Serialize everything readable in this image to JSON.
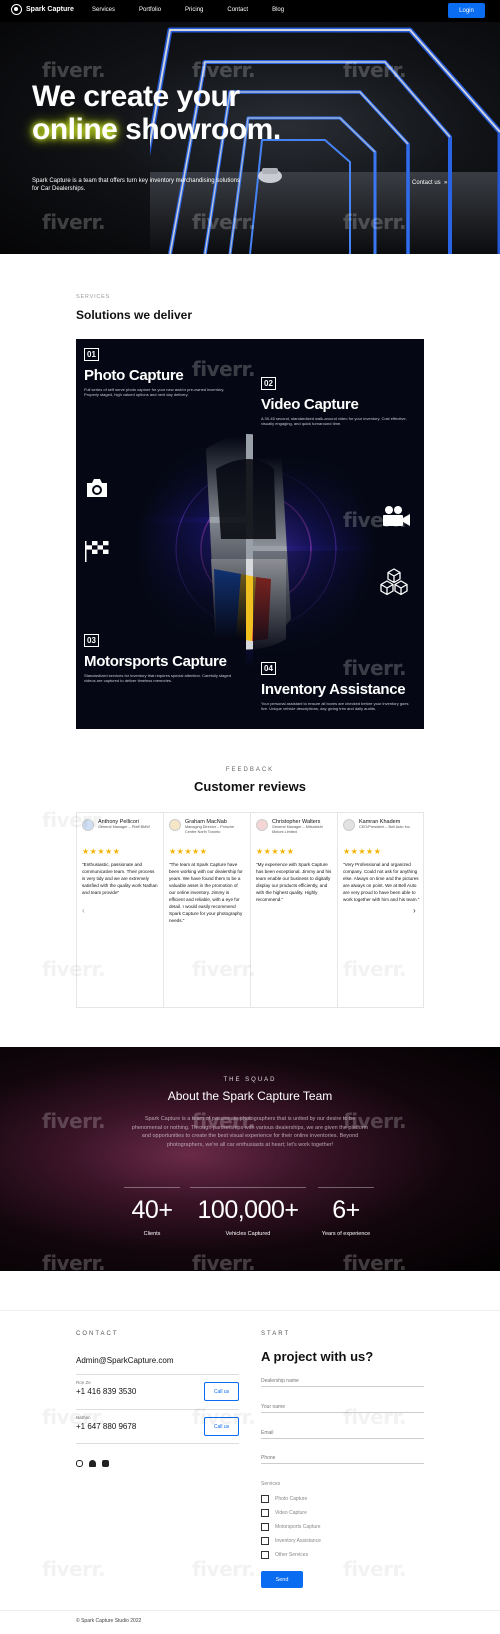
{
  "nav": {
    "brand": "Spark Capture",
    "links": [
      "Services",
      "Portfolio",
      "Pricing",
      "Contact",
      "Blog"
    ],
    "login": "Login"
  },
  "hero": {
    "line1": "We create your",
    "line2_highlight": "online",
    "line2_rest": " showroom.",
    "subtitle": "Spark Capture is a team that offers turn key inventory merchandising solutions for Car Dealerships.",
    "cta": "Contact us",
    "watermark": "fiverr."
  },
  "services": {
    "kicker": "SERVICES",
    "title": "Solutions we deliver",
    "cards": [
      {
        "num": "01",
        "title": "Photo Capture",
        "desc": "Full series of self serve photo capture for your new and/or pre-owned inventory. Properly staged, high valued options and next day delivery.",
        "icon": "camera-icon"
      },
      {
        "num": "02",
        "title": "Video Capture",
        "desc": "A 30-45 second, standardized walk-around video for your inventory. Cost effective, visually engaging, and quick turnaround time.",
        "icon": "video-camera-icon"
      },
      {
        "num": "03",
        "title": "Motorsports Capture",
        "desc": "Standardized services for inventory that requires special attention. Carefully staged videos are captured to deliver timeless memories.",
        "icon": "checkered-flag-icon"
      },
      {
        "num": "04",
        "title": "Inventory Assistance",
        "desc": "Your personal assistant to ensure all boxes are checked before your inventory goes live. Unique vehicle descriptions, day giving trim and daily audits.",
        "icon": "cubes-icon"
      }
    ]
  },
  "reviews": {
    "kicker": "FEEDBACK",
    "title": "Customer reviews",
    "stars": "★★★★★",
    "items": [
      {
        "name": "Anthony Pellicori",
        "role": "General Manager – Pfaff BMW",
        "text": "\"Enthusiastic, passionate and communicative team. Their process is very tidy and we are extremely satisfied with the quality work Nathan and team provide\""
      },
      {
        "name": "Graham MacNab",
        "role": "Managing Director – Porsche Centre North Toronto",
        "text": "\"The team at Spark Capture have been working with our dealership for years. We have found them to be a valuable asset in the promotion of our online inventory. Jimmy is efficient and reliable, with a eye for detail. I would easily recommend Spark Capture for your photography needs.\""
      },
      {
        "name": "Christopher Walters",
        "role": "General Manager – Mitsubishi Motors Limited",
        "text": "\"My experience with Spark Capture has been exceptional. Jimmy and his team enable our business to digitally display our products efficiently, and with the highest quality. Highly recommend.\""
      },
      {
        "name": "Kamran Khadem",
        "role": "CEO/President – Bell Auto Inc.",
        "text": "\"Very Professional and organized company. Could not ask for anything else. Always on time and the pictures are always on point. We at Bell Auto are very proud to have been able to work together with him and his team.\""
      }
    ]
  },
  "squad": {
    "kicker": "THE SQUAD",
    "title": "About the Spark Capture Team",
    "text": "Spark Capture is a team of passionate photographers that is united by our desire to be phenomenal or nothing. Through partnerships with various dealerships, we are given the platform and opportunities to create the best visual experience for their online inventories. Beyond photographers, we're all car enthusiasts at heart; let's work together!",
    "stats": [
      {
        "value": "40+",
        "label": "Clients"
      },
      {
        "value": "100,000+",
        "label": "Vehicles Captured"
      },
      {
        "value": "6+",
        "label": "Years of experience"
      }
    ]
  },
  "contact": {
    "kicker": "CONTACT",
    "email": "Admin@SparkCapture.com",
    "people": [
      {
        "name": "Ron Ze",
        "phone": "+1 416 839 3530",
        "button": "Call us"
      },
      {
        "name": "Nathan",
        "phone": "+1 647 880 9678",
        "button": "Call us"
      }
    ]
  },
  "form": {
    "kicker": "START",
    "title": "A project with us?",
    "fields": [
      "Dealership name",
      "Your name",
      "Email",
      "Phone"
    ],
    "services_label": "Services",
    "options": [
      "Photo Capture",
      "Video Capture",
      "Motorsports Capture",
      "Inventory Assistance",
      "Other Services"
    ],
    "submit": "Send"
  },
  "footer": {
    "copyright": "© Spark Capture Studio 2022"
  }
}
